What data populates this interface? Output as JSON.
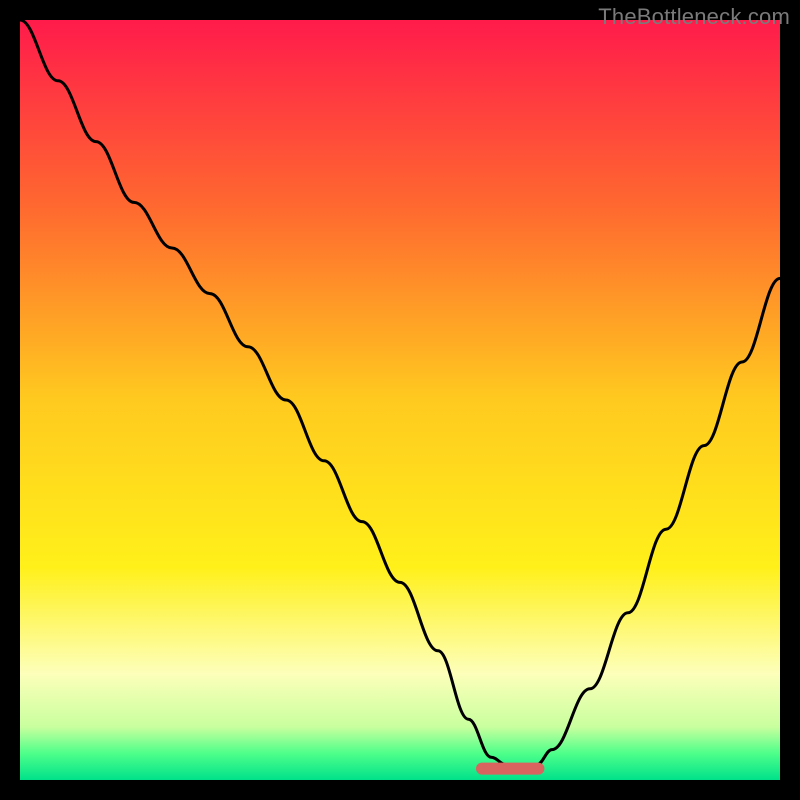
{
  "watermark": "TheBottleneck.com",
  "chart_data": {
    "type": "line",
    "title": "",
    "xlabel": "",
    "ylabel": "",
    "xlim": [
      0,
      100
    ],
    "ylim": [
      0,
      100
    ],
    "grid": false,
    "legend": false,
    "background_gradient_stops": [
      {
        "offset": 0.0,
        "color": "#ff1b4b"
      },
      {
        "offset": 0.25,
        "color": "#ff6a2f"
      },
      {
        "offset": 0.5,
        "color": "#ffca1f"
      },
      {
        "offset": 0.72,
        "color": "#fff01a"
      },
      {
        "offset": 0.86,
        "color": "#fdffba"
      },
      {
        "offset": 0.93,
        "color": "#c9ff9e"
      },
      {
        "offset": 0.965,
        "color": "#4eff8a"
      },
      {
        "offset": 1.0,
        "color": "#00e18a"
      }
    ],
    "series": [
      {
        "name": "bottleneck-curve",
        "type": "line",
        "color": "#000000",
        "x": [
          0,
          5,
          10,
          15,
          20,
          25,
          30,
          35,
          40,
          45,
          50,
          55,
          59,
          62,
          64,
          68,
          70,
          75,
          80,
          85,
          90,
          95,
          100
        ],
        "y": [
          100,
          92,
          84,
          76,
          70,
          64,
          57,
          50,
          42,
          34,
          26,
          17,
          8,
          3,
          2,
          2,
          4,
          12,
          22,
          33,
          44,
          55,
          66
        ]
      }
    ],
    "optimal_marker": {
      "x_start": 60,
      "x_end": 69,
      "y": 1.5,
      "color": "#d9635f"
    }
  }
}
